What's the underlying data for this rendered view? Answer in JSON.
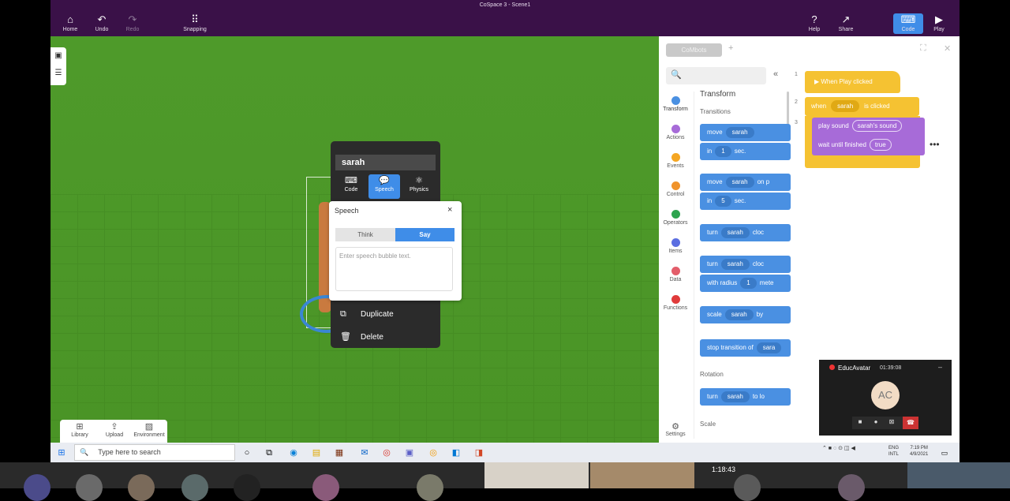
{
  "window": {
    "title": "CoSpace 3 - Scene1"
  },
  "toolbar": {
    "home": "Home",
    "undo": "Undo",
    "redo": "Redo",
    "snapping": "Snapping",
    "help": "Help",
    "share": "Share",
    "code": "Code",
    "play": "Play"
  },
  "scene": {
    "left_tools": [
      "window-icon",
      "list-icon"
    ],
    "bottom_tools": {
      "library": "Library",
      "upload": "Upload",
      "environment": "Environment"
    }
  },
  "context_menu": {
    "object_name": "sarah",
    "tabs": {
      "code": "Code",
      "speech": "Speech",
      "physics": "Physics"
    },
    "items": {
      "duplicate": "Duplicate",
      "delete": "Delete"
    }
  },
  "speech_popup": {
    "title": "Speech",
    "close": "×",
    "think": "Think",
    "say": "Say",
    "placeholder": "Enter speech bubble text."
  },
  "editor": {
    "tab_label": "CoMbots",
    "add_tab": "+",
    "categories": [
      {
        "label": "Transform",
        "color": "#4a90e2"
      },
      {
        "label": "Actions",
        "color": "#a76bd8"
      },
      {
        "label": "Events",
        "color": "#f5a623"
      },
      {
        "label": "Control",
        "color": "#f0932b"
      },
      {
        "label": "Operators",
        "color": "#2ea44f"
      },
      {
        "label": "Items",
        "color": "#5b6ee1"
      },
      {
        "label": "Data",
        "color": "#e35d6a"
      },
      {
        "label": "Functions",
        "color": "#e03b3b"
      }
    ],
    "settings": "Settings",
    "palette": {
      "title": "Transform",
      "transitions": "Transitions",
      "rotation": "Rotation",
      "scale_section": "Scale",
      "blocks": {
        "move1_a": "move",
        "move1_obj": "sarah",
        "move1_in": "in",
        "move1_num": "1",
        "move1_sec": "sec.",
        "move2_a": "move",
        "move2_obj": "sarah",
        "move2_tail": "on p",
        "move2_in": "in",
        "move2_num": "5",
        "move2_sec": "sec.",
        "turn1": "turn",
        "turn1_obj": "sarah",
        "turn1_tail": "cloc",
        "turn2": "turn",
        "turn2_obj": "sarah",
        "turn2_tail": "cloc",
        "turn2_radius": "with radius",
        "turn2_num": "1",
        "turn2_unit": "mete",
        "scale": "scale",
        "scale_obj": "sarah",
        "scale_by": "by",
        "stop": "stop transition of",
        "stop_obj": "sara",
        "turn3": "turn",
        "turn3_obj": "sarah",
        "turn3_tail": "to lo"
      }
    },
    "workspace": {
      "line_numbers": [
        "1",
        "2",
        "3"
      ],
      "event": "When Play clicked",
      "when": "when",
      "when_obj": "sarah",
      "is_clicked": "is clicked",
      "play_sound": "play sound",
      "sound_name": "sarah's sound",
      "wait": "wait until finished",
      "wait_val": "true",
      "more": "•••"
    }
  },
  "call": {
    "name": "EducAvatar",
    "time": "01:39:08",
    "initials": "AC"
  },
  "taskbar": {
    "search_placeholder": "Type here to search",
    "lang": "ENG",
    "lang2": "INTL",
    "time": "7:19 PM",
    "date": "4/9/2021"
  },
  "meeting": {
    "elapsed": "1:18:43"
  }
}
